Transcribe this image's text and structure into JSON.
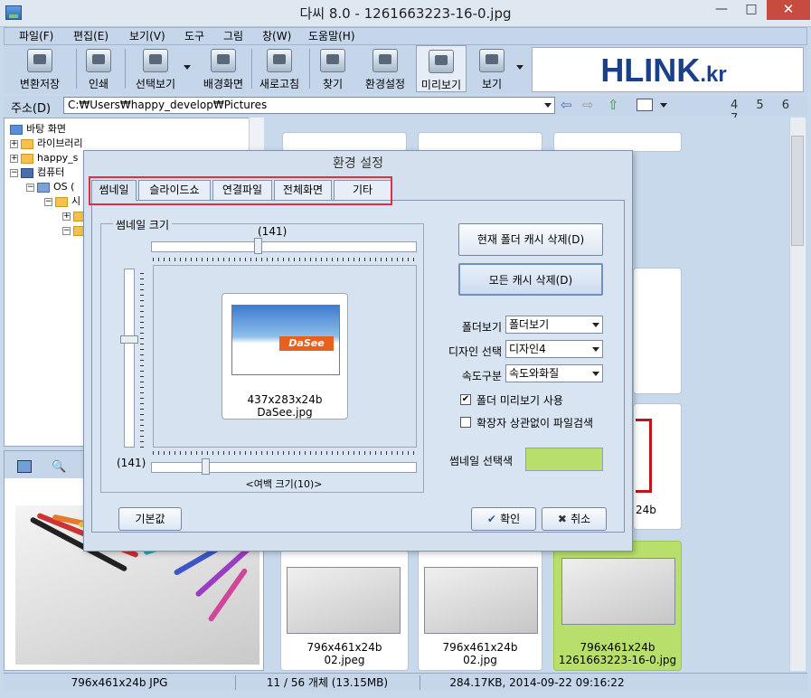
{
  "window": {
    "title": "다씨 8.0 - 1261663223-16-0.jpg",
    "minimize": "—",
    "maximize": "□",
    "close": "✕"
  },
  "menu": [
    "파일(F)",
    "편집(E)",
    "보기(V)",
    "도구",
    "그림",
    "창(W)",
    "도움말(H)"
  ],
  "toolbar": {
    "items": [
      "변환저장",
      "인쇄",
      "선택보기",
      "배경화면",
      "새로고침",
      "찾기",
      "환경설정",
      "미리보기",
      "보기"
    ],
    "banner": {
      "brand": "HLINK",
      "suffix": ".kr"
    }
  },
  "address": {
    "label": "주소(D)",
    "value": "C:₩Users₩happy_develop₩Pictures",
    "page_numbers": "4 5 6 7"
  },
  "tree": {
    "items": [
      "바탕 화면",
      "라이브러리",
      "happy_s",
      "컴퓨터",
      "OS (",
      "시"
    ]
  },
  "thumbs": [
    {
      "caption1": "796x461x24b",
      "caption2": "02.jpeg"
    },
    {
      "caption1": "796x461x24b",
      "caption2": "02.jpg"
    },
    {
      "caption1": "796x461x24b",
      "caption2": "1261663223-16-0.jpg"
    }
  ],
  "partial_caption": "24b",
  "status": {
    "image_info": "796x461x24b JPG",
    "count": "11 / 56 개체 (13.15MB)",
    "file_info": "284.17KB, 2014-09-22 09:16:22"
  },
  "dialog": {
    "title": "환경 설정",
    "tabs": [
      "썸네일",
      "슬라이드쇼",
      "연결파일",
      "전체화면",
      "기타"
    ],
    "group_label": "썸네일 크기",
    "size_top": "(141)",
    "size_left": "(141)",
    "margin_label": "<여백 크기(10)>",
    "preview": {
      "logo_text": "DaSee",
      "dims": "437x283x24b",
      "filename": "DaSee.jpg"
    },
    "buttons": {
      "clear_folder_cache": "현재 폴더 캐시 삭제(D)",
      "clear_all_cache": "모든 캐시 삭제(D)",
      "default": "기본값",
      "ok": "확인",
      "cancel": "취소"
    },
    "fields": [
      {
        "label": "폴더보기",
        "value": "폴더보기"
      },
      {
        "label": "디자인 선택",
        "value": "디자인4"
      },
      {
        "label": "속도구분",
        "value": "속도와화질"
      }
    ],
    "checkboxes": [
      {
        "label": "폴더 미리보기 사용",
        "checked": true
      },
      {
        "label": "확장자 상관없이 파일검색",
        "checked": false
      }
    ],
    "color_label": "썸네일 선택색",
    "color_value": "#b8df6b"
  }
}
